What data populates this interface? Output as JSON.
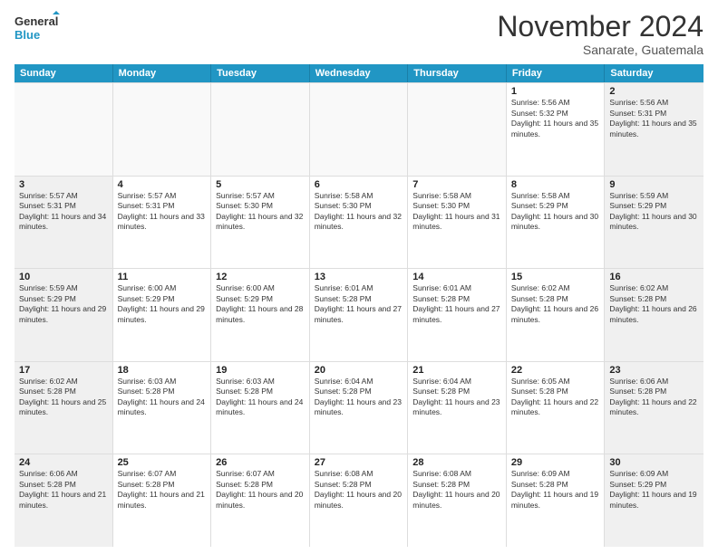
{
  "logo": {
    "line1": "General",
    "line2": "Blue"
  },
  "title": "November 2024",
  "location": "Sanarate, Guatemala",
  "days_of_week": [
    "Sunday",
    "Monday",
    "Tuesday",
    "Wednesday",
    "Thursday",
    "Friday",
    "Saturday"
  ],
  "rows": [
    [
      {
        "num": "",
        "info": "",
        "empty": true
      },
      {
        "num": "",
        "info": "",
        "empty": true
      },
      {
        "num": "",
        "info": "",
        "empty": true
      },
      {
        "num": "",
        "info": "",
        "empty": true
      },
      {
        "num": "",
        "info": "",
        "empty": true
      },
      {
        "num": "1",
        "info": "Sunrise: 5:56 AM\nSunset: 5:32 PM\nDaylight: 11 hours and 35 minutes."
      },
      {
        "num": "2",
        "info": "Sunrise: 5:56 AM\nSunset: 5:31 PM\nDaylight: 11 hours and 35 minutes.",
        "shaded": true
      }
    ],
    [
      {
        "num": "3",
        "info": "Sunrise: 5:57 AM\nSunset: 5:31 PM\nDaylight: 11 hours and 34 minutes.",
        "shaded": true
      },
      {
        "num": "4",
        "info": "Sunrise: 5:57 AM\nSunset: 5:31 PM\nDaylight: 11 hours and 33 minutes."
      },
      {
        "num": "5",
        "info": "Sunrise: 5:57 AM\nSunset: 5:30 PM\nDaylight: 11 hours and 32 minutes."
      },
      {
        "num": "6",
        "info": "Sunrise: 5:58 AM\nSunset: 5:30 PM\nDaylight: 11 hours and 32 minutes."
      },
      {
        "num": "7",
        "info": "Sunrise: 5:58 AM\nSunset: 5:30 PM\nDaylight: 11 hours and 31 minutes."
      },
      {
        "num": "8",
        "info": "Sunrise: 5:58 AM\nSunset: 5:29 PM\nDaylight: 11 hours and 30 minutes."
      },
      {
        "num": "9",
        "info": "Sunrise: 5:59 AM\nSunset: 5:29 PM\nDaylight: 11 hours and 30 minutes.",
        "shaded": true
      }
    ],
    [
      {
        "num": "10",
        "info": "Sunrise: 5:59 AM\nSunset: 5:29 PM\nDaylight: 11 hours and 29 minutes.",
        "shaded": true
      },
      {
        "num": "11",
        "info": "Sunrise: 6:00 AM\nSunset: 5:29 PM\nDaylight: 11 hours and 29 minutes."
      },
      {
        "num": "12",
        "info": "Sunrise: 6:00 AM\nSunset: 5:29 PM\nDaylight: 11 hours and 28 minutes."
      },
      {
        "num": "13",
        "info": "Sunrise: 6:01 AM\nSunset: 5:28 PM\nDaylight: 11 hours and 27 minutes."
      },
      {
        "num": "14",
        "info": "Sunrise: 6:01 AM\nSunset: 5:28 PM\nDaylight: 11 hours and 27 minutes."
      },
      {
        "num": "15",
        "info": "Sunrise: 6:02 AM\nSunset: 5:28 PM\nDaylight: 11 hours and 26 minutes."
      },
      {
        "num": "16",
        "info": "Sunrise: 6:02 AM\nSunset: 5:28 PM\nDaylight: 11 hours and 26 minutes.",
        "shaded": true
      }
    ],
    [
      {
        "num": "17",
        "info": "Sunrise: 6:02 AM\nSunset: 5:28 PM\nDaylight: 11 hours and 25 minutes.",
        "shaded": true
      },
      {
        "num": "18",
        "info": "Sunrise: 6:03 AM\nSunset: 5:28 PM\nDaylight: 11 hours and 24 minutes."
      },
      {
        "num": "19",
        "info": "Sunrise: 6:03 AM\nSunset: 5:28 PM\nDaylight: 11 hours and 24 minutes."
      },
      {
        "num": "20",
        "info": "Sunrise: 6:04 AM\nSunset: 5:28 PM\nDaylight: 11 hours and 23 minutes."
      },
      {
        "num": "21",
        "info": "Sunrise: 6:04 AM\nSunset: 5:28 PM\nDaylight: 11 hours and 23 minutes."
      },
      {
        "num": "22",
        "info": "Sunrise: 6:05 AM\nSunset: 5:28 PM\nDaylight: 11 hours and 22 minutes."
      },
      {
        "num": "23",
        "info": "Sunrise: 6:06 AM\nSunset: 5:28 PM\nDaylight: 11 hours and 22 minutes.",
        "shaded": true
      }
    ],
    [
      {
        "num": "24",
        "info": "Sunrise: 6:06 AM\nSunset: 5:28 PM\nDaylight: 11 hours and 21 minutes.",
        "shaded": true
      },
      {
        "num": "25",
        "info": "Sunrise: 6:07 AM\nSunset: 5:28 PM\nDaylight: 11 hours and 21 minutes."
      },
      {
        "num": "26",
        "info": "Sunrise: 6:07 AM\nSunset: 5:28 PM\nDaylight: 11 hours and 20 minutes."
      },
      {
        "num": "27",
        "info": "Sunrise: 6:08 AM\nSunset: 5:28 PM\nDaylight: 11 hours and 20 minutes."
      },
      {
        "num": "28",
        "info": "Sunrise: 6:08 AM\nSunset: 5:28 PM\nDaylight: 11 hours and 20 minutes."
      },
      {
        "num": "29",
        "info": "Sunrise: 6:09 AM\nSunset: 5:28 PM\nDaylight: 11 hours and 19 minutes."
      },
      {
        "num": "30",
        "info": "Sunrise: 6:09 AM\nSunset: 5:29 PM\nDaylight: 11 hours and 19 minutes.",
        "shaded": true
      }
    ]
  ]
}
